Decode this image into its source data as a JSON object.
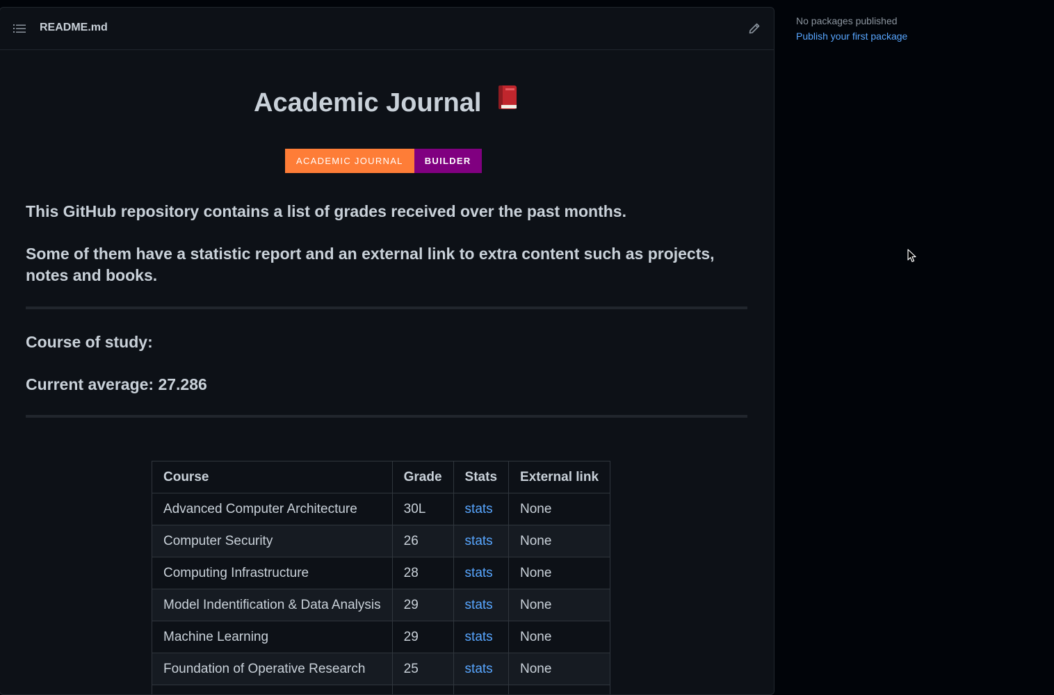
{
  "readme": {
    "file_name": "README.md",
    "title": "Academic Journal",
    "title_emoji": "📕",
    "badge": {
      "left": "ACADEMIC JOURNAL",
      "right": "BUILDER",
      "left_color": "#fe7d37",
      "right_color": "#800080"
    },
    "paragraph1": "This GitHub repository contains a list of grades received over the past months.",
    "paragraph2": "Some of them have a statistic report and an external link to extra content such as projects, notes and books.",
    "course_of_study": "Course of study:",
    "current_average": "Current average: 27.286",
    "table": {
      "headers": [
        "Course",
        "Grade",
        "Stats",
        "External link"
      ],
      "rows": [
        {
          "course": "Advanced Computer Architecture",
          "grade": "30L",
          "stats": "stats",
          "link": "None"
        },
        {
          "course": "Computer Security",
          "grade": "26",
          "stats": "stats",
          "link": "None"
        },
        {
          "course": "Computing Infrastructure",
          "grade": "28",
          "stats": "stats",
          "link": "None"
        },
        {
          "course": "Model Indentification & Data Analysis",
          "grade": "29",
          "stats": "stats",
          "link": "None"
        },
        {
          "course": "Machine Learning",
          "grade": "29",
          "stats": "stats",
          "link": "None"
        },
        {
          "course": "Foundation of Operative Research",
          "grade": "25",
          "stats": "stats",
          "link": "None"
        }
      ]
    }
  },
  "sidebar": {
    "packages_text": "No packages published",
    "publish_link": "Publish your first package"
  },
  "icons": {
    "toc": "list-unordered-icon",
    "edit": "pencil-icon",
    "cursor": "mouse-pointer-icon"
  }
}
